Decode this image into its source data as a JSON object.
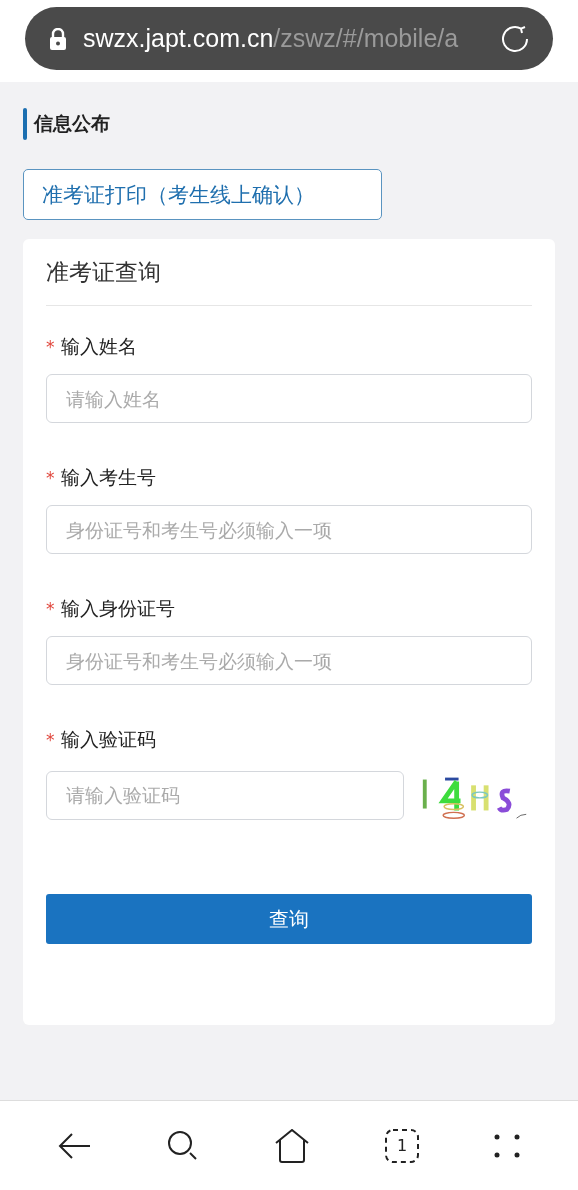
{
  "address_bar": {
    "host": "swzx.japt.com.cn",
    "path": "/zswz/#/mobile/a"
  },
  "section_title": "信息公布",
  "print_button": "准考证打印（考生线上确认）",
  "card": {
    "title": "准考证查询",
    "fields": [
      {
        "kind": "text",
        "required_mark": "*",
        "label": "输入姓名",
        "placeholder": "请输入姓名"
      },
      {
        "kind": "text",
        "required_mark": "*",
        "label": "输入考生号",
        "placeholder": "身份证号和考生号必须输入一项"
      },
      {
        "kind": "text",
        "required_mark": "*",
        "label": "输入身份证号",
        "placeholder": "身份证号和考生号必须输入一项"
      },
      {
        "kind": "captcha",
        "required_mark": "*",
        "label": "输入验证码",
        "placeholder": "请输入验证码"
      }
    ],
    "submit": "查询"
  },
  "bottom_nav": {
    "tab_count": "1"
  }
}
